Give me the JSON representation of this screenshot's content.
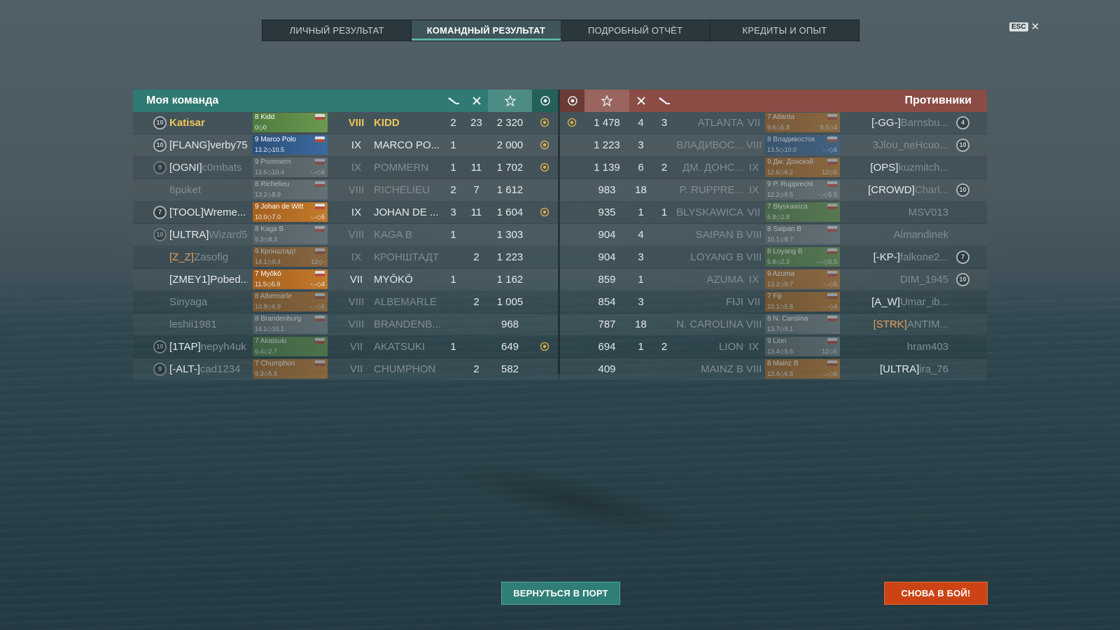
{
  "tabs": [
    "ЛИЧНЫЙ РЕЗУЛЬТАТ",
    "КОМАНДНЫЙ РЕЗУЛЬТАТ",
    "ПОДРОБНЫЙ ОТЧЁТ",
    "КРЕДИТЫ И ОПЫТ"
  ],
  "active_tab": 1,
  "esc_label": "ESC",
  "close_glyph": "✕",
  "my_team": {
    "title": "Моя команда",
    "header_icons": [
      "ships-sunk-icon",
      "planes-destroyed-icon",
      "base-xp-star-icon",
      "medal-icon"
    ],
    "rows": [
      {
        "rank": "10",
        "tag": "",
        "name": "Katisar",
        "highlight": "self",
        "card": {
          "name": "8 Kidd",
          "stat": "0◇0",
          "extra": "",
          "color": "green"
        },
        "tier": "VIII",
        "ship": "KIDD",
        "kills": "2",
        "planes": "23",
        "xp": "2 320",
        "medal": true
      },
      {
        "rank": "10",
        "tag": "[FLANG]",
        "name": "verby75",
        "card": {
          "name": "9 Marco Polo",
          "stat": "13.2◇10.5",
          "extra": "",
          "color": "blue"
        },
        "tier": "IX",
        "ship": "MARCO PO...",
        "kills": "1",
        "planes": "",
        "xp": "2 000",
        "medal": true
      },
      {
        "rank": "9",
        "tag": "[OGNI]",
        "name": "c0mbats",
        "name_dim": true,
        "card": {
          "name": "9 Pommern",
          "stat": "13.6◇10.4",
          "extra": "-.-◇6",
          "color": "grey",
          "dim": true
        },
        "tier": "IX",
        "ship": "POMMERN",
        "kills": "1",
        "planes": "11",
        "xp": "1 702",
        "medal": true
      },
      {
        "rank": "",
        "tag": "",
        "name": "6puket",
        "name_dim": true,
        "card": {
          "name": "8 Richelieu",
          "stat": "13.2◇8.9",
          "extra": "",
          "color": "grey",
          "dim": true
        },
        "tier": "VIII",
        "ship": "RICHELIEU",
        "kills": "2",
        "planes": "7",
        "xp": "1 612",
        "medal": false
      },
      {
        "rank": "7",
        "tag": "[TOOL]",
        "name": "Wreme...",
        "card": {
          "name": "9 Johan de Witt",
          "stat": "10.0◇7.0",
          "extra": "-.-◇5",
          "color": "orange"
        },
        "tier": "IX",
        "ship": "JOHAN DE ...",
        "kills": "3",
        "planes": "11",
        "xp": "1 604",
        "medal": true
      },
      {
        "rank": "10",
        "tag": "[ULTRA]",
        "name": "Wizard5",
        "name_dim": true,
        "card": {
          "name": "8 Kaga B",
          "stat": "9.3◇8.3",
          "extra": "",
          "color": "grey",
          "dim": true
        },
        "tier": "VIII",
        "ship": "KAGA B",
        "kills": "1",
        "planes": "",
        "xp": "1 303",
        "medal": false
      },
      {
        "rank": "",
        "tag": "[Z_Z]",
        "name": "Zasofig",
        "tag_orange": true,
        "name_dim": true,
        "card": {
          "name": "9 Кронштадт",
          "stat": "14.1◇9.4",
          "extra": "12◇-",
          "color": "orange",
          "dim": true
        },
        "tier": "IX",
        "ship": "КРОНШТАДТ",
        "kills": "",
        "planes": "2",
        "xp": "1 223",
        "medal": false
      },
      {
        "rank": "",
        "tag": "[ZMEY1]",
        "name": "Pobed...",
        "card": {
          "name": "7 Myōkō",
          "stat": "11.5◇5.9",
          "extra": "-.-◇4",
          "color": "orange"
        },
        "tier": "VII",
        "ship": "MYŌKŌ",
        "kills": "1",
        "planes": "",
        "xp": "1 162",
        "medal": false
      },
      {
        "rank": "",
        "tag": "",
        "name": "Sinyaga",
        "name_dim": true,
        "card": {
          "name": "8 Albemarle",
          "stat": "10.8◇6.9",
          "extra": "-.-◇5",
          "color": "orange",
          "dim": true
        },
        "tier": "VIII",
        "ship": "ALBEMARLE",
        "kills": "",
        "planes": "2",
        "xp": "1 005",
        "medal": false
      },
      {
        "rank": "",
        "tag": "",
        "name": "leshii1981",
        "name_dim": true,
        "card": {
          "name": "8 Brandenburg",
          "stat": "14.1◇10.1",
          "extra": "",
          "color": "grey",
          "dim": true
        },
        "tier": "VIII",
        "ship": "BRANDENB...",
        "kills": "",
        "planes": "",
        "xp": "968",
        "medal": false
      },
      {
        "rank": "10",
        "tag": "[1TAP]",
        "name": "nepyh4uk",
        "name_dim": true,
        "card": {
          "name": "7 Akatsuki",
          "stat": "6.4◇2.7",
          "extra": "",
          "color": "green",
          "dim": true
        },
        "tier": "VII",
        "ship": "AKATSUKI",
        "kills": "1",
        "planes": "",
        "xp": "649",
        "medal": true
      },
      {
        "rank": "9",
        "tag": "[-ALT-]",
        "name": "cad1234",
        "name_dim": true,
        "card": {
          "name": "7 Chumphon",
          "stat": "9.3◇5.8",
          "extra": "",
          "color": "orange",
          "dim": true
        },
        "tier": "VII",
        "ship": "CHUMPHON",
        "kills": "",
        "planes": "2",
        "xp": "582",
        "medal": false
      }
    ]
  },
  "enemy_team": {
    "title": "Противники",
    "header_icons": [
      "medal-icon",
      "base-xp-star-icon",
      "planes-destroyed-icon",
      "ships-sunk-icon"
    ],
    "rows": [
      {
        "medal": true,
        "xp": "1 478",
        "planes": "4",
        "kills": "3",
        "ship": "ATLANTA",
        "tier": "VII",
        "card": {
          "name": "7 Atlanta",
          "stat": "9.6◇5.8",
          "extra": "8.5◇4",
          "color": "orange",
          "dim": true
        },
        "tag": "[-GG-]",
        "name": "Barnsbu...",
        "rank": "4"
      },
      {
        "medal": false,
        "xp": "1 223",
        "planes": "3",
        "kills": "",
        "ship": "ВЛАДИВОС...",
        "tier": "VIII",
        "card": {
          "name": "8 Владивосток",
          "stat": "13.5◇10.0",
          "extra": "-.-◇6",
          "color": "blue",
          "dim": true
        },
        "tag": "",
        "name": "3Jlou_neHcuo...",
        "rank": "10"
      },
      {
        "medal": false,
        "xp": "1 139",
        "planes": "6",
        "kills": "2",
        "ship": "ДМ. ДОНС...",
        "tier": "IX",
        "card": {
          "name": "9 Дм. Донской",
          "stat": "12.6◇6.2",
          "extra": "12◇5",
          "color": "orange",
          "dim": true
        },
        "tag": "[OPS]",
        "name": "kuzmitch...",
        "rank": ""
      },
      {
        "medal": false,
        "xp": "983",
        "planes": "18",
        "kills": "",
        "ship": "P. RUPPRE...",
        "tier": "IX",
        "card": {
          "name": "9 P. Rupprecht",
          "stat": "12.2◇9.5",
          "extra": "-.-◇5.5",
          "color": "grey",
          "dim": true
        },
        "tag": "[CROWD]",
        "name": "Charl...",
        "rank": "10"
      },
      {
        "medal": false,
        "xp": "935",
        "planes": "1",
        "kills": "1",
        "ship": "BLYSKAWICA",
        "tier": "VII",
        "card": {
          "name": "7 Błyskawica",
          "stat": "6.8◇2.8",
          "extra": "",
          "color": "green",
          "dim": true
        },
        "tag": "",
        "name": "MSV013",
        "rank": ""
      },
      {
        "medal": false,
        "xp": "904",
        "planes": "4",
        "kills": "",
        "ship": "SAIPAN B",
        "tier": "VIII",
        "card": {
          "name": "8 Saipan B",
          "stat": "10.1◇8.7",
          "extra": "",
          "color": "grey",
          "dim": true
        },
        "tag": "",
        "name": "Almandinek",
        "rank": ""
      },
      {
        "medal": false,
        "xp": "904",
        "planes": "3",
        "kills": "",
        "ship": "LOYANG B",
        "tier": "VIII",
        "card": {
          "name": "8 Loyang B",
          "stat": "5.8◇2.3",
          "extra": "-.-◇5.5",
          "color": "green",
          "dim": true
        },
        "tag": "[-KP-]",
        "name": "falkone2...",
        "rank": "7"
      },
      {
        "medal": false,
        "xp": "859",
        "planes": "1",
        "kills": "",
        "ship": "AZUMA",
        "tier": "IX",
        "card": {
          "name": "9 Azuma",
          "stat": "13.2◇9.7",
          "extra": "-.-◇5",
          "color": "orange",
          "dim": true
        },
        "tag": "",
        "name": "DIM_1945",
        "rank": "10"
      },
      {
        "medal": false,
        "xp": "854",
        "planes": "3",
        "kills": "",
        "ship": "FIJI",
        "tier": "VII",
        "card": {
          "name": "7 Fiji",
          "stat": "10.1◇5.8",
          "extra": "-.-◇4",
          "color": "orange",
          "dim": true
        },
        "tag": "[A_W]",
        "name": "Umar_ib...",
        "rank": ""
      },
      {
        "medal": false,
        "xp": "787",
        "planes": "18",
        "kills": "",
        "ship": "N. CAROLINA",
        "tier": "VIII",
        "card": {
          "name": "8 N. Carolina",
          "stat": "13.7◇9.1",
          "extra": "",
          "color": "grey",
          "dim": true
        },
        "tag": "[STRK]",
        "name": "ANTIM...",
        "tag_orange": true,
        "rank": ""
      },
      {
        "medal": false,
        "xp": "694",
        "planes": "1",
        "kills": "2",
        "ship": "LION",
        "tier": "IX",
        "card": {
          "name": "9 Lion",
          "stat": "13.4◇9.5",
          "extra": "12◇5",
          "color": "grey",
          "dim": true
        },
        "tag": "",
        "name": "hram403",
        "rank": ""
      },
      {
        "medal": false,
        "xp": "409",
        "planes": "",
        "kills": "",
        "ship": "MAINZ B",
        "tier": "VIII",
        "card": {
          "name": "8 Mainz B",
          "stat": "13.4◇6.8",
          "extra": "-.-◇6",
          "color": "orange",
          "dim": true
        },
        "tag": "[ULTRA]",
        "name": "ira_76",
        "rank": ""
      }
    ]
  },
  "buttons": {
    "port": "ВЕРНУТЬСЯ В ПОРТ",
    "fight": "СНОВА В БОЙ!"
  },
  "colors": {
    "accent": "#2f7a72",
    "enemy": "#8a4c45",
    "gold": "#f1c45a",
    "fight": "#cc4415"
  }
}
